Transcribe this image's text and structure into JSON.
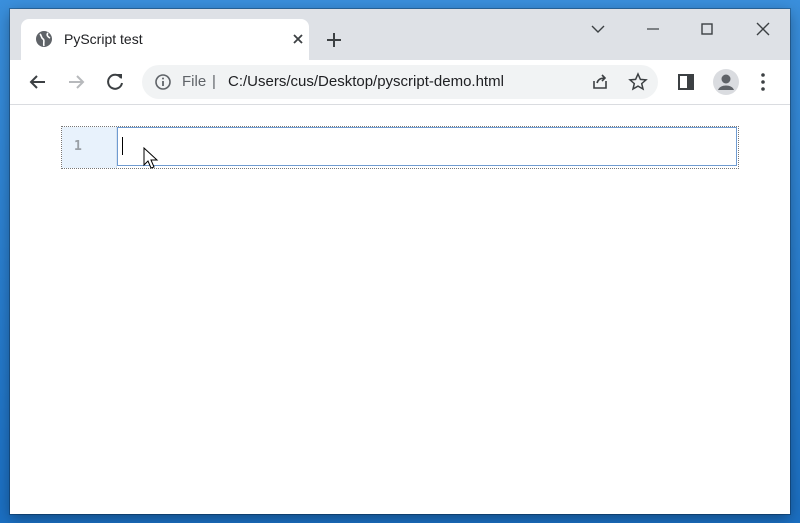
{
  "browser": {
    "tab_title": "PyScript test",
    "url_scheme": "File",
    "url_separator": "|",
    "url": "C:/Users/cus/Desktop/pyscript-demo.html",
    "icons": {
      "favicon": "globe-icon",
      "tab_close": "close-icon",
      "new_tab": "plus-icon",
      "tab_search": "chevron-down-icon",
      "minimize": "minimize-icon",
      "maximize": "maximize-icon",
      "close": "close-icon",
      "back": "back-arrow-icon",
      "forward": "forward-arrow-icon",
      "reload": "reload-icon",
      "site_info": "info-icon",
      "share": "share-icon",
      "bookmark": "star-icon",
      "side_panel": "side-panel-icon",
      "profile": "profile-icon",
      "menu": "kebab-menu-icon"
    }
  },
  "editor": {
    "line_numbers": [
      "1"
    ],
    "code": ""
  }
}
